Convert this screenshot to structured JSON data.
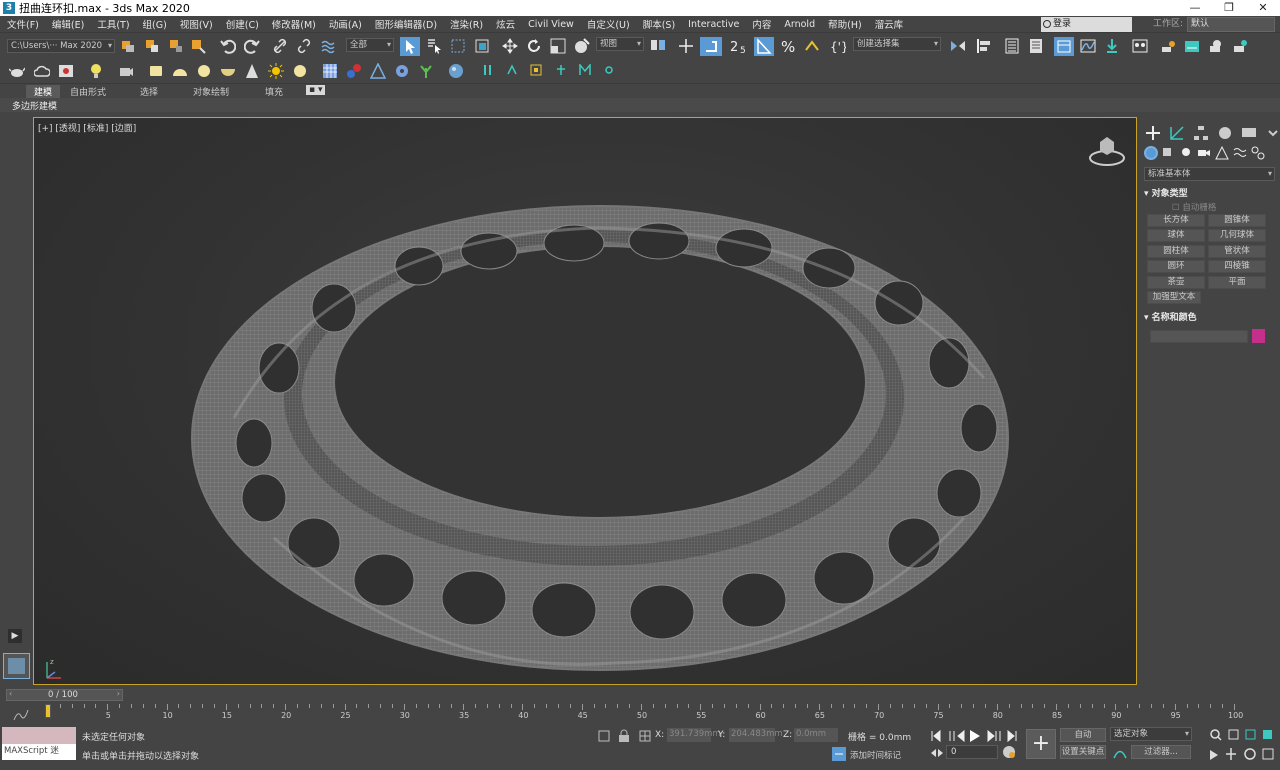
{
  "window": {
    "title": "扭曲连环扣.max - 3ds Max 2020",
    "app_icon": "3"
  },
  "menu": [
    "文件(F)",
    "编辑(E)",
    "工具(T)",
    "组(G)",
    "视图(V)",
    "创建(C)",
    "修改器(M)",
    "动画(A)",
    "图形编辑器(D)",
    "渲染(R)",
    "炫云",
    "Civil View",
    "自定义(U)",
    "脚本(S)",
    "Interactive",
    "内容",
    "Arnold",
    "帮助(H)",
    "溜云库"
  ],
  "login": "登录",
  "workspace_label": "工作区:",
  "workspace_value": "默认",
  "toolbar": {
    "project_path": "C:\\Users\\··· Max 2020",
    "selection_filter": "全部",
    "ref_coord": "视图",
    "named_sel": "创建选择集"
  },
  "ribbon": {
    "tabs": [
      "建模",
      "自由形式",
      "选择",
      "对象绘制",
      "填充"
    ],
    "active": "建模",
    "sub": "多边形建模"
  },
  "viewport": {
    "label": "[+] [透视] [标准] [边面]"
  },
  "command_panel": {
    "category": "标准基本体",
    "rollout_object_type": "对象类型",
    "auto_grid": "自动栅格",
    "buttons": [
      "长方体",
      "圆锥体",
      "球体",
      "几何球体",
      "圆柱体",
      "管状体",
      "圆环",
      "四棱锥",
      "茶壶",
      "平面",
      "加强型文本"
    ],
    "rollout_name_color": "名称和颜色",
    "object_color": "#c42f8b"
  },
  "timeline": {
    "frame_display": "0 / 100",
    "ticks": [
      "0",
      "5",
      "10",
      "15",
      "20",
      "25",
      "30",
      "35",
      "40",
      "45",
      "50",
      "55",
      "60",
      "65",
      "70",
      "75",
      "80",
      "85",
      "90",
      "95",
      "100"
    ]
  },
  "status": {
    "maxscript": "MAXScript 迷",
    "line1": "未选定任何对象",
    "line2": "单击或单击并拖动以选择对象",
    "x_label": "X:",
    "x_value": "391.739mm",
    "y_label": "Y:",
    "y_value": "204.483mm",
    "z_label": "Z:",
    "z_value": "0.0mm",
    "grid": "栅格 = 0.0mm",
    "add_time_tag": "添加时间标记",
    "auto_key": "自动",
    "set_key": "设置关键点",
    "sel_obj": "选定对象",
    "filters": "过滤器...",
    "frame": "0"
  },
  "colors": {
    "accent": "#c9a227",
    "toggle_blue": "#5b9bd5"
  }
}
